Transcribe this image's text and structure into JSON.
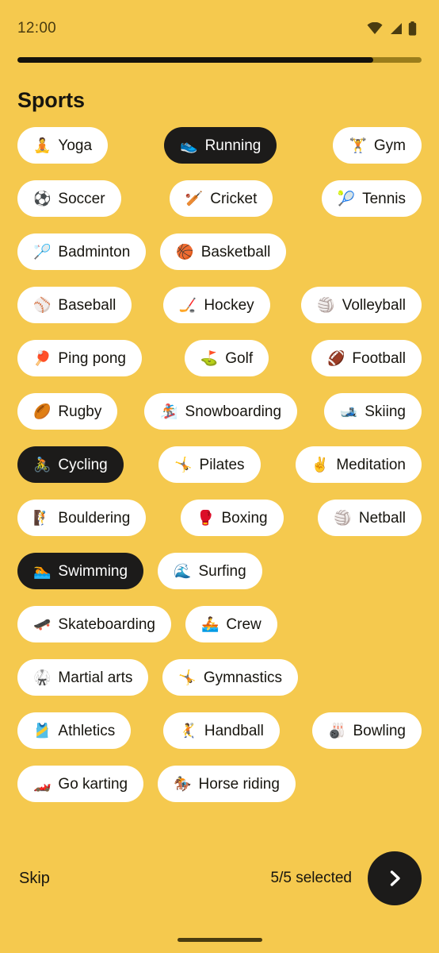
{
  "status_bar": {
    "time": "12:00",
    "wifi_icon": "wifi-icon",
    "signal_icon": "cellular-signal-icon",
    "battery_icon": "battery-icon"
  },
  "progress": {
    "percent": 88
  },
  "header": {
    "title": "Sports"
  },
  "colors": {
    "background": "#F5C94E",
    "chip_unselected_bg": "#FFFFFF",
    "chip_selected_bg": "#1C1B1A",
    "text_dark": "#17150F",
    "text_light": "#FFFFFF",
    "progress_fill": "#14120C",
    "progress_track": "#9A7D1C"
  },
  "chip_rows": [
    {
      "align": "between",
      "chips": [
        {
          "emoji": "🧘",
          "label": "Yoga",
          "selected": false
        },
        {
          "emoji": "👟",
          "label": "Running",
          "selected": true
        },
        {
          "emoji": "🏋️",
          "label": "Gym",
          "selected": false
        }
      ]
    },
    {
      "align": "between",
      "chips": [
        {
          "emoji": "⚽",
          "label": "Soccer",
          "selected": false
        },
        {
          "emoji": "🏏",
          "label": "Cricket",
          "selected": false
        },
        {
          "emoji": "🎾",
          "label": "Tennis",
          "selected": false
        }
      ]
    },
    {
      "align": "left",
      "chips": [
        {
          "emoji": "🏸",
          "label": "Badminton",
          "selected": false
        },
        {
          "emoji": "🏀",
          "label": "Basketball",
          "selected": false
        }
      ]
    },
    {
      "align": "between",
      "chips": [
        {
          "emoji": "⚾",
          "label": "Baseball",
          "selected": false
        },
        {
          "emoji": "🏒",
          "label": "Hockey",
          "selected": false
        },
        {
          "emoji": "🏐",
          "label": "Volleyball",
          "selected": false
        }
      ]
    },
    {
      "align": "between",
      "chips": [
        {
          "emoji": "🏓",
          "label": "Ping pong",
          "selected": false
        },
        {
          "emoji": "⛳",
          "label": "Golf",
          "selected": false
        },
        {
          "emoji": "🏈",
          "label": "Football",
          "selected": false
        }
      ]
    },
    {
      "align": "between",
      "chips": [
        {
          "emoji": "🏉",
          "label": "Rugby",
          "selected": false
        },
        {
          "emoji": "🏂",
          "label": "Snowboarding",
          "selected": false
        },
        {
          "emoji": "🎿",
          "label": "Skiing",
          "selected": false
        }
      ]
    },
    {
      "align": "between",
      "chips": [
        {
          "emoji": "🚴",
          "label": "Cycling",
          "selected": true
        },
        {
          "emoji": "🤸",
          "label": "Pilates",
          "selected": false
        },
        {
          "emoji": "✌️",
          "label": "Meditation",
          "selected": false
        }
      ]
    },
    {
      "align": "between",
      "chips": [
        {
          "emoji": "🧗",
          "label": "Bouldering",
          "selected": false
        },
        {
          "emoji": "🥊",
          "label": "Boxing",
          "selected": false
        },
        {
          "emoji": "🏐",
          "label": "Netball",
          "selected": false
        }
      ]
    },
    {
      "align": "left",
      "chips": [
        {
          "emoji": "🏊",
          "label": "Swimming",
          "selected": true
        },
        {
          "emoji": "🌊",
          "label": "Surfing",
          "selected": false
        }
      ]
    },
    {
      "align": "left",
      "chips": [
        {
          "emoji": "🛹",
          "label": "Skateboarding",
          "selected": false
        },
        {
          "emoji": "🚣",
          "label": "Crew",
          "selected": false
        }
      ]
    },
    {
      "align": "left",
      "chips": [
        {
          "emoji": "🥋",
          "label": "Martial arts",
          "selected": false
        },
        {
          "emoji": "🤸",
          "label": "Gymnastics",
          "selected": false
        }
      ]
    },
    {
      "align": "between",
      "chips": [
        {
          "emoji": "🎽",
          "label": "Athletics",
          "selected": false
        },
        {
          "emoji": "🤾",
          "label": "Handball",
          "selected": false
        },
        {
          "emoji": "🎳",
          "label": "Bowling",
          "selected": false
        }
      ]
    },
    {
      "align": "left",
      "chips": [
        {
          "emoji": "🏎️",
          "label": "Go karting",
          "selected": false
        },
        {
          "emoji": "🏇",
          "label": "Horse riding",
          "selected": false
        }
      ]
    }
  ],
  "footer": {
    "skip_label": "Skip",
    "selected_count": "5/5 selected",
    "next_icon": "chevron-right-icon"
  }
}
